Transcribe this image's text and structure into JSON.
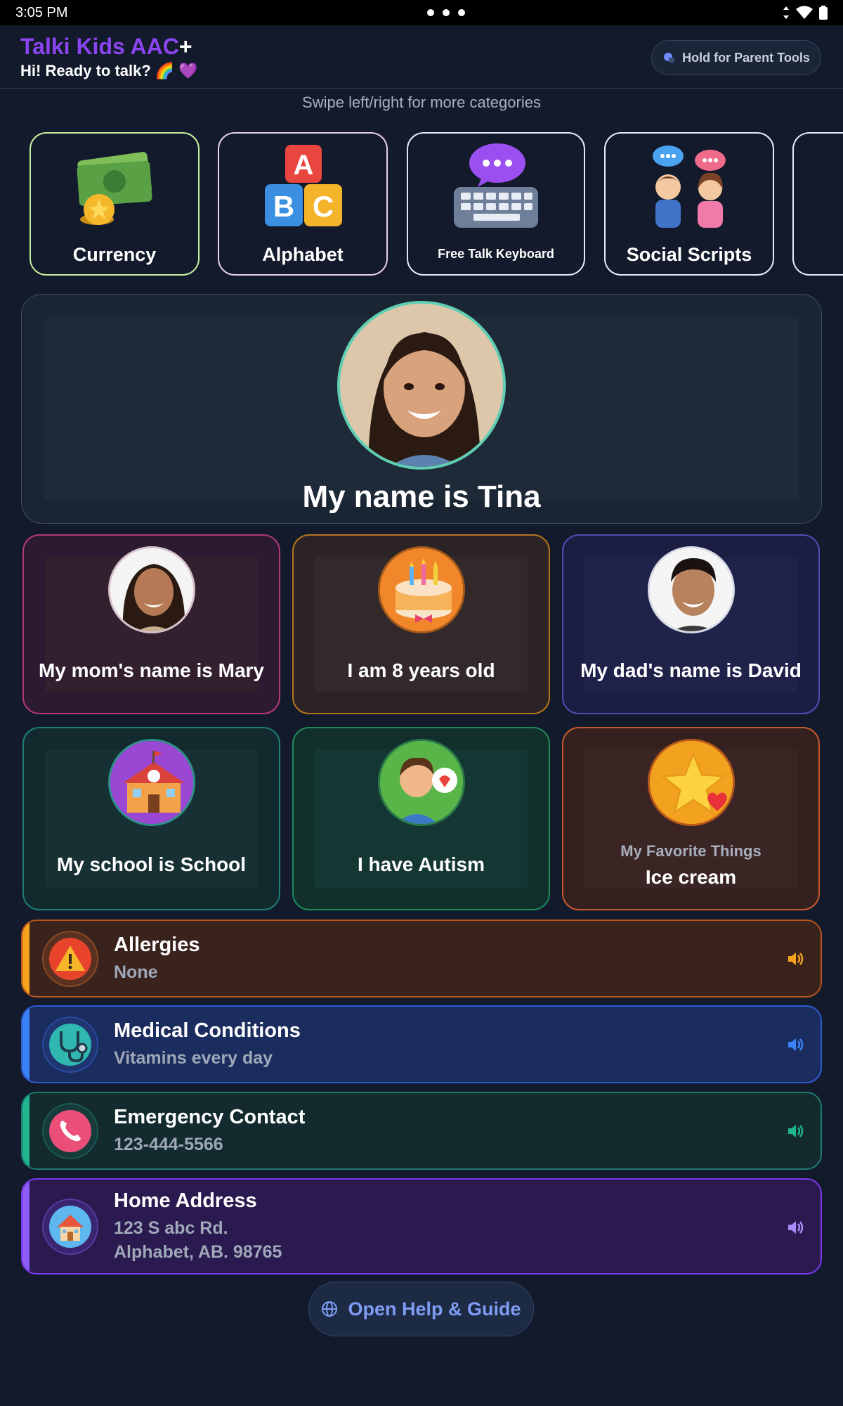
{
  "status_bar": {
    "time": "3:05 PM"
  },
  "header": {
    "app_title": "Talki Kids AAC",
    "app_title_plus": "+",
    "greeting": "Hi! Ready to talk? 🌈 💜",
    "parent_tools_label": "Hold for Parent Tools"
  },
  "swipe_hint": "Swipe left/right for more categories",
  "categories": [
    {
      "label": "Currency",
      "border": "#c9ef9e"
    },
    {
      "label": "Alphabet",
      "border": "#e6cdf5"
    },
    {
      "label": "Free Talk Keyboard",
      "border": "#e8e8f4"
    },
    {
      "label": "Social Scripts",
      "border": "#e6edf7"
    }
  ],
  "profile": {
    "name_sentence": "My name is Tina"
  },
  "tiles": [
    {
      "label": "My mom's name is Mary",
      "border": "#b3387a",
      "bg": "#2b1a30",
      "inner": "#33202f"
    },
    {
      "label": "I am 8 years old",
      "border": "#b8741d",
      "bg": "#2b2325",
      "inner": "#33292b"
    },
    {
      "label": "My dad's name is David",
      "border": "#4b4fb5",
      "bg": "#1b1d42",
      "inner": "#1f2349"
    },
    {
      "label": "My school is School",
      "border": "#1f7d73",
      "bg": "#122a2e",
      "inner": "#163033"
    },
    {
      "label": "I have Autism",
      "border": "#1e8a5a",
      "bg": "#11302c",
      "inner": "#153733"
    },
    {
      "sub_label": "My Favorite Things",
      "label": "Ice cream",
      "border": "#c35a2c",
      "bg": "#34201f",
      "inner": "#3a2524"
    }
  ],
  "info_rows": [
    {
      "title": "Allergies",
      "value": "None",
      "accent": "#f5a21c",
      "border": "#b4541f",
      "bg": "#3a221d",
      "speaker": "#f5a21c"
    },
    {
      "title": "Medical Conditions",
      "value": "Vitamins every day",
      "accent": "#3b82f6",
      "border": "#2f5bd0",
      "bg": "#1b2c5e",
      "speaker": "#3b82f6"
    },
    {
      "title": "Emergency Contact",
      "value": "123-444-5566",
      "accent": "#1fb58f",
      "border": "#1c7c6c",
      "bg": "#132a2f",
      "speaker": "#1fb58f"
    },
    {
      "title": "Home Address",
      "value_line1": "123 S abc Rd.",
      "value_line2": "Alphabet, AB. 98765",
      "accent": "#8b5cf6",
      "border": "#7c3aed",
      "bg": "#2a1a50",
      "speaker": "#a78bfa"
    }
  ],
  "help_button_label": "Open Help & Guide"
}
